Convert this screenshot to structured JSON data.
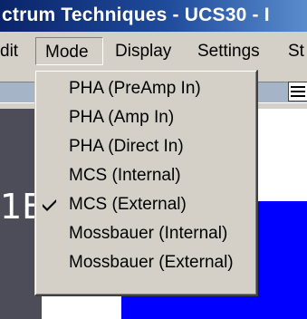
{
  "window": {
    "title": "ctrum Techniques - UCS30 - I"
  },
  "menu_bar": {
    "items": [
      {
        "label": "dit"
      },
      {
        "label": "Mode"
      },
      {
        "label": "Display"
      },
      {
        "label": "Settings"
      },
      {
        "label": "St"
      }
    ]
  },
  "mode_menu": {
    "items": [
      {
        "label": "PHA (PreAmp In)",
        "checked": false
      },
      {
        "label": "PHA (Amp In)",
        "checked": false
      },
      {
        "label": "PHA (Direct In)",
        "checked": false
      },
      {
        "label": "MCS (Internal)",
        "checked": false
      },
      {
        "label": "MCS (External)",
        "checked": true
      },
      {
        "label": "Mossbauer (Internal)",
        "checked": false
      },
      {
        "label": "Mossbauer (External)",
        "checked": false
      }
    ]
  },
  "main": {
    "left_readout": "1E"
  },
  "colors": {
    "title_bar": "#0a246a",
    "menu_bg": "#d4d0c8",
    "plot_bg": "#0000ff",
    "left_panel": "#4d4d59"
  },
  "icons": {
    "toolbar_icon": "list-icon",
    "check": "check-icon"
  }
}
